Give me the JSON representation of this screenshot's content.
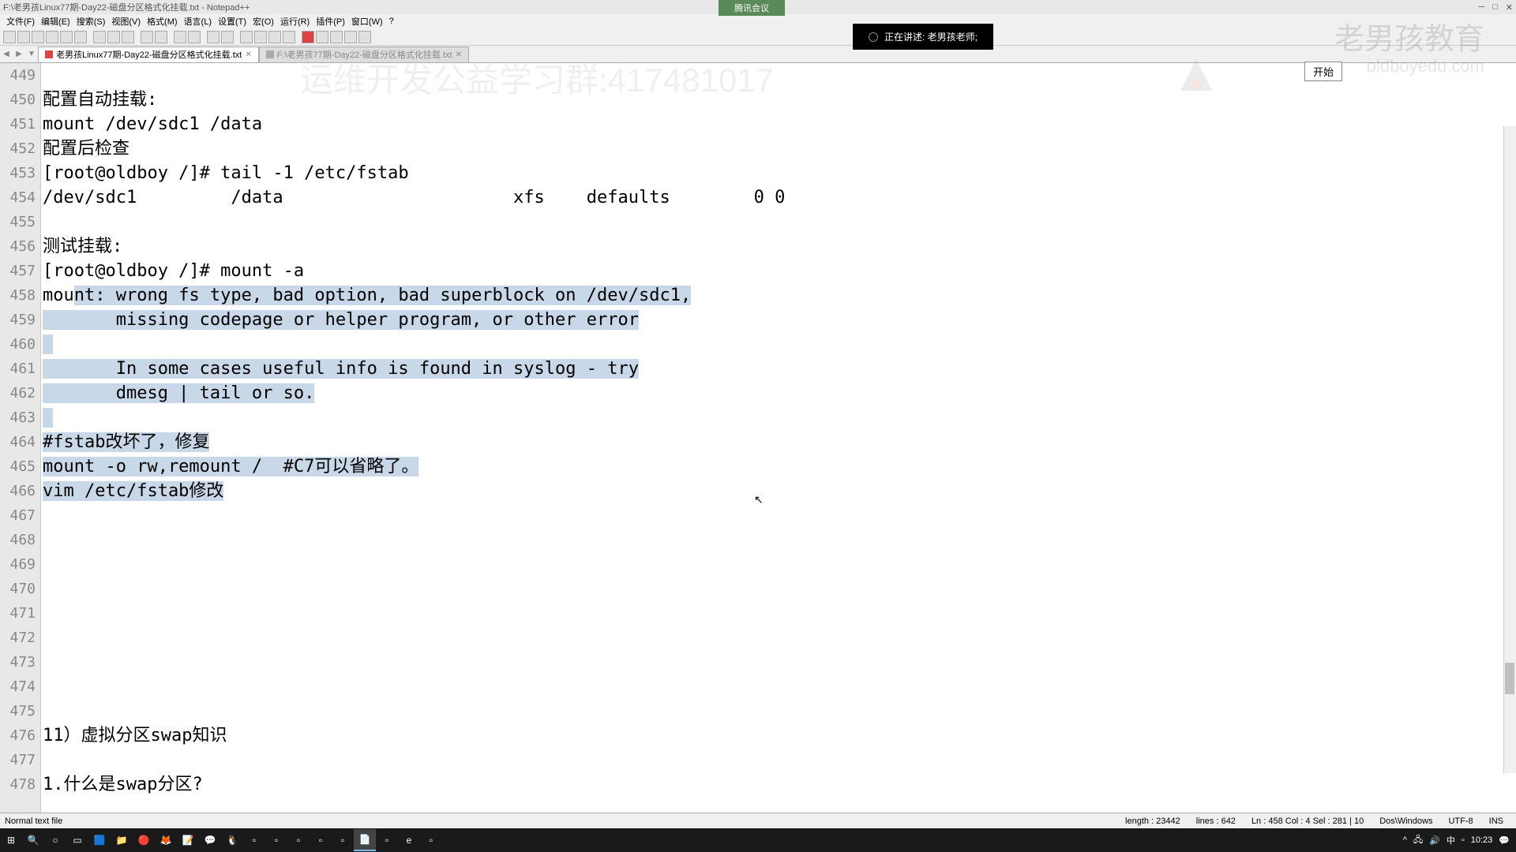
{
  "window": {
    "title": "F:\\老男孩Linux77期-Day22-磁盘分区格式化挂载.txt - Notepad++"
  },
  "menus": [
    "文件(F)",
    "编辑(E)",
    "搜索(S)",
    "视图(V)",
    "格式(M)",
    "语言(L)",
    "设置(T)",
    "宏(O)",
    "运行(R)",
    "插件(P)",
    "窗口(W)",
    "?"
  ],
  "tabs": {
    "active": "老男孩Linux77期-Day22-磁盘分区格式化挂载.txt",
    "inactive": "F:\\老男孩77期-Day22-磁盘分区格式化挂载.txt"
  },
  "lines": [
    {
      "n": 449,
      "t": ""
    },
    {
      "n": 450,
      "t": "配置自动挂载:"
    },
    {
      "n": 451,
      "t": "mount /dev/sdc1 /data"
    },
    {
      "n": 452,
      "t": "配置后检查"
    },
    {
      "n": 453,
      "t": "[root@oldboy /]# tail -1 /etc/fstab"
    },
    {
      "n": 454,
      "t": "/dev/sdc1         /data                      xfs    defaults        0 0"
    },
    {
      "n": 455,
      "t": ""
    },
    {
      "n": 456,
      "t": "测试挂载:"
    },
    {
      "n": 457,
      "t": "[root@oldboy /]# mount -a"
    },
    {
      "n": 458,
      "t": "mount: wrong fs type, bad option, bad superblock on /dev/sdc1,",
      "sel": true,
      "prefix": "mou"
    },
    {
      "n": 459,
      "t": "       missing codepage or helper program, or other error",
      "sel": true
    },
    {
      "n": 460,
      "t": "",
      "sel": true
    },
    {
      "n": 461,
      "t": "       In some cases useful info is found in syslog - try",
      "sel": true
    },
    {
      "n": 462,
      "t": "       dmesg | tail or so.",
      "sel": true
    },
    {
      "n": 463,
      "t": "",
      "sel": true
    },
    {
      "n": 464,
      "t": "#fstab改坏了，修复",
      "sel": true
    },
    {
      "n": 465,
      "t": "mount -o rw,remount /  #C7可以省略了。",
      "sel": true
    },
    {
      "n": 466,
      "t": "vim /etc/fstab修改",
      "sel": true
    },
    {
      "n": 467,
      "t": ""
    },
    {
      "n": 468,
      "t": ""
    },
    {
      "n": 469,
      "t": ""
    },
    {
      "n": 470,
      "t": ""
    },
    {
      "n": 471,
      "t": ""
    },
    {
      "n": 472,
      "t": ""
    },
    {
      "n": 473,
      "t": ""
    },
    {
      "n": 474,
      "t": ""
    },
    {
      "n": 475,
      "t": ""
    },
    {
      "n": 476,
      "t": "11）虚拟分区swap知识"
    },
    {
      "n": 477,
      "t": ""
    },
    {
      "n": 478,
      "t": "1.什么是swap分区?"
    }
  ],
  "status": {
    "filetype": "Normal text file",
    "length": "length : 23442",
    "lines": "lines : 642",
    "pos": "Ln : 458    Col : 4    Sel : 281 | 10",
    "eol": "Dos\\Windows",
    "enc": "UTF-8",
    "ins": "INS"
  },
  "banner": "腾讯会议",
  "recording": "正在讲述: 老男孩老师;",
  "watermark": {
    "main": "老男孩教育",
    "sub": "oldboyedu.com"
  },
  "start_button": "开始",
  "ghost": "运维开发公益学习群:417481017",
  "tray": {
    "time": "10:23"
  },
  "taskbar_icons": [
    "win",
    "search",
    "cortana",
    "store",
    "edge",
    "folder",
    "chrome",
    "firefox",
    "note",
    "wechat",
    "qq",
    "app1",
    "app2",
    "app3",
    "app4",
    "app5",
    "npp",
    "app6",
    "ie",
    "app7"
  ]
}
